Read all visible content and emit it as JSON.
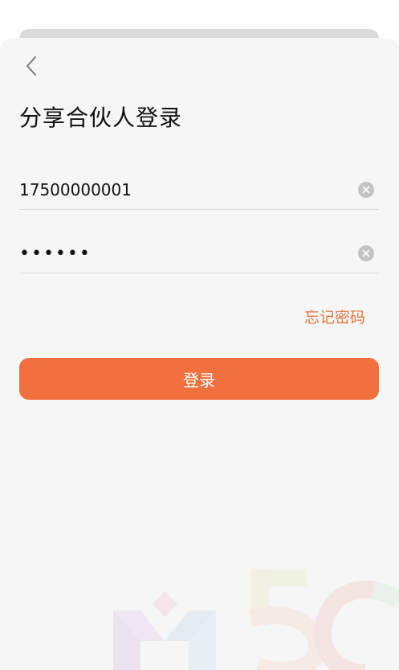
{
  "header": {
    "title": "分享合伙人登录"
  },
  "form": {
    "phone_value": "17500000001",
    "password_masked": "••••••"
  },
  "links": {
    "forgot_password": "忘记密码"
  },
  "actions": {
    "login_label": "登录"
  },
  "colors": {
    "accent": "#f2703d",
    "link": "#e8753f",
    "background": "#f6f6f6"
  },
  "icons": {
    "back": "chevron-left-icon",
    "clear": "clear-circle-icon"
  }
}
